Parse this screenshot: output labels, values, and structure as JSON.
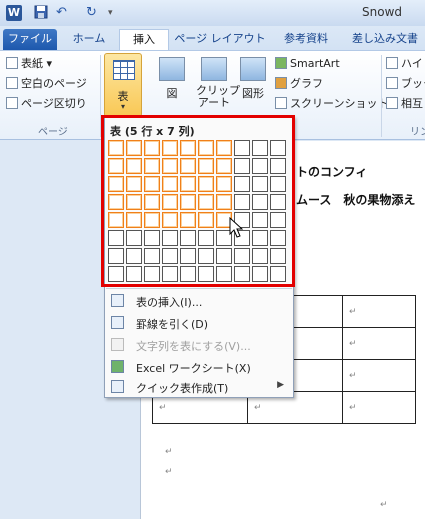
{
  "titlebar": {
    "app_logo": "W",
    "undo_glyph": "↶",
    "redo_glyph": "↻",
    "qat_menu_glyph": "▾",
    "doc_title": "Snowd"
  },
  "tabs": {
    "file": "ファイル",
    "home": "ホーム",
    "insert": "挿入",
    "page_layout": "ページ レイアウト",
    "references": "参考資料",
    "mailings": "差し込み文書"
  },
  "ribbon": {
    "pages_group": {
      "cover_page": "表紙 ▾",
      "blank_page": "空白のページ",
      "page_break": "ページ区切り",
      "label": "ページ"
    },
    "table_button": {
      "label": "表",
      "arrow": "▾"
    },
    "picture": "図",
    "clip_art": "クリップ\nアート",
    "shapes": "図形",
    "smartart": "SmartArt",
    "chart": "グラフ",
    "screenshot": "スクリーンショット ▾",
    "hyperlink": "ハイ",
    "bookmark": "ブック",
    "cross_ref": "相互",
    "links_label": "リン"
  },
  "table_menu": {
    "header": "表 (5 行 x 7 列)",
    "grid_rows": 8,
    "grid_cols": 10,
    "selected_rows": 5,
    "selected_cols": 7,
    "items": [
      {
        "label": "表の挿入(I)...",
        "enabled": true,
        "icon": "insert-table-icon"
      },
      {
        "label": "罫線を引く(D)",
        "enabled": true,
        "icon": "draw-table-icon"
      },
      {
        "label": "文字列を表にする(V)...",
        "enabled": false,
        "icon": "convert-text-icon"
      },
      {
        "label": "Excel ワークシート(X)",
        "enabled": true,
        "icon": "excel-icon"
      },
      {
        "label": "クイック表作成(T)",
        "enabled": true,
        "icon": "quick-tables-icon",
        "submenu": true
      }
    ]
  },
  "document": {
    "line1": "トのコンフィ",
    "line2": "ムース　秋の果物添え",
    "para_mark": "↵"
  }
}
